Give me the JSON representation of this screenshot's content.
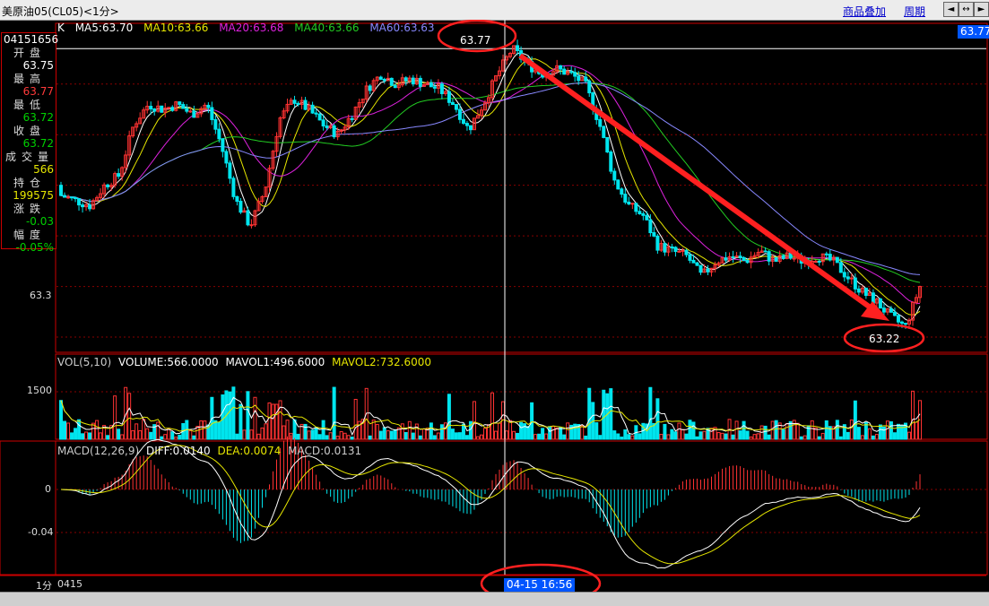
{
  "titlebar": {
    "title": "美原油05(CL05)<1分>",
    "btn_overlay": "商品叠加",
    "btn_period": "周期",
    "nav_buttons": [
      "◄",
      "↔",
      "►"
    ]
  },
  "info": {
    "code": "04151656",
    "rows": [
      {
        "label": "开盘",
        "value": "63.75",
        "color": "w"
      },
      {
        "label": "最高",
        "value": "63.77",
        "color": "r"
      },
      {
        "label": "最低",
        "value": "63.72",
        "color": "g"
      },
      {
        "label": "收盘",
        "value": "63.72",
        "color": "g"
      },
      {
        "label": "成交量",
        "value": "566",
        "color": "y"
      },
      {
        "label": "持仓",
        "value": "199575",
        "color": "y"
      },
      {
        "label": "涨跌",
        "value": "-0.03",
        "color": "g"
      },
      {
        "label": "幅度",
        "value": "-0.05%",
        "color": "g"
      }
    ]
  },
  "legend_price": {
    "k": "K",
    "ma5": "MA5:63.70",
    "ma10": "MA10:63.66",
    "ma20": "MA20:63.68",
    "ma40": "MA40:63.66",
    "ma60": "MA60:63.63"
  },
  "legend_vol": {
    "label": "VOL(5,10)",
    "volume": "VOLUME:566.0000",
    "mavol1": "MAVOL1:496.6000",
    "mavol2": "MAVOL2:732.6000"
  },
  "legend_macd": {
    "label": "MACD(12,26,9)",
    "diff": "DIFF:0.0140",
    "dea": "DEA:0.0074",
    "macd": "MACD:0.0131"
  },
  "axes": {
    "price_tick": "63.3",
    "vol_tick": "1500",
    "macd_tick_0": "0",
    "macd_tick_neg": "-0.04",
    "period": "1分",
    "date_start": "0415"
  },
  "cursor_time": "04-15 16:56",
  "right_price": "63.77",
  "annotations": {
    "high": "63.77",
    "low": "63.22"
  },
  "colors": {
    "up": "#ff3232",
    "down": "#00e5ee",
    "ma5": "#ffffff",
    "ma10": "#e6e600",
    "ma20": "#dd22dd",
    "ma40": "#22cc22",
    "ma60": "#8888ff",
    "grid": "#880000",
    "arrow": "#ff2020"
  },
  "chart_data": {
    "type": "candlestick",
    "price_range": [
      63.17,
      63.82
    ],
    "candles_sample": [
      [
        63.5,
        63.48
      ],
      [
        63.48,
        63.47
      ],
      [
        63.47,
        63.46
      ],
      [
        63.46,
        63.5
      ],
      [
        63.5,
        63.52
      ],
      [
        63.52,
        63.62
      ],
      [
        63.62,
        63.66
      ],
      [
        63.66,
        63.65
      ],
      [
        63.65,
        63.66
      ],
      [
        63.66,
        63.64
      ],
      [
        63.64,
        63.66
      ],
      [
        63.66,
        63.58
      ],
      [
        63.58,
        63.47
      ],
      [
        63.47,
        63.42
      ],
      [
        63.42,
        63.49
      ],
      [
        63.49,
        63.63
      ],
      [
        63.63,
        63.67
      ],
      [
        63.67,
        63.65
      ],
      [
        63.65,
        63.62
      ],
      [
        63.62,
        63.6
      ],
      [
        63.6,
        63.64
      ],
      [
        63.64,
        63.69
      ],
      [
        63.69,
        63.72
      ],
      [
        63.72,
        63.7
      ],
      [
        63.7,
        63.71
      ],
      [
        63.71,
        63.7
      ],
      [
        63.7,
        63.69
      ],
      [
        63.69,
        63.66
      ],
      [
        63.66,
        63.61
      ],
      [
        63.61,
        63.66
      ],
      [
        63.66,
        63.72
      ],
      [
        63.72,
        63.77
      ],
      [
        63.77,
        63.74
      ],
      [
        63.74,
        63.72
      ],
      [
        63.72,
        63.73
      ],
      [
        63.73,
        63.72
      ],
      [
        63.72,
        63.7
      ],
      [
        63.7,
        63.62
      ],
      [
        63.62,
        63.51
      ],
      [
        63.51,
        63.46
      ],
      [
        63.46,
        63.44
      ],
      [
        63.44,
        63.38
      ],
      [
        63.38,
        63.37
      ],
      [
        63.37,
        63.36
      ],
      [
        63.36,
        63.32
      ],
      [
        63.32,
        63.35
      ],
      [
        63.35,
        63.36
      ],
      [
        63.36,
        63.35
      ],
      [
        63.35,
        63.37
      ],
      [
        63.37,
        63.35
      ],
      [
        63.35,
        63.36
      ],
      [
        63.36,
        63.35
      ],
      [
        63.35,
        63.36
      ],
      [
        63.36,
        63.35
      ],
      [
        63.35,
        63.32
      ],
      [
        63.32,
        63.29
      ],
      [
        63.29,
        63.27
      ],
      [
        63.27,
        63.24
      ],
      [
        63.24,
        63.22
      ],
      [
        63.22,
        63.3
      ]
    ]
  }
}
